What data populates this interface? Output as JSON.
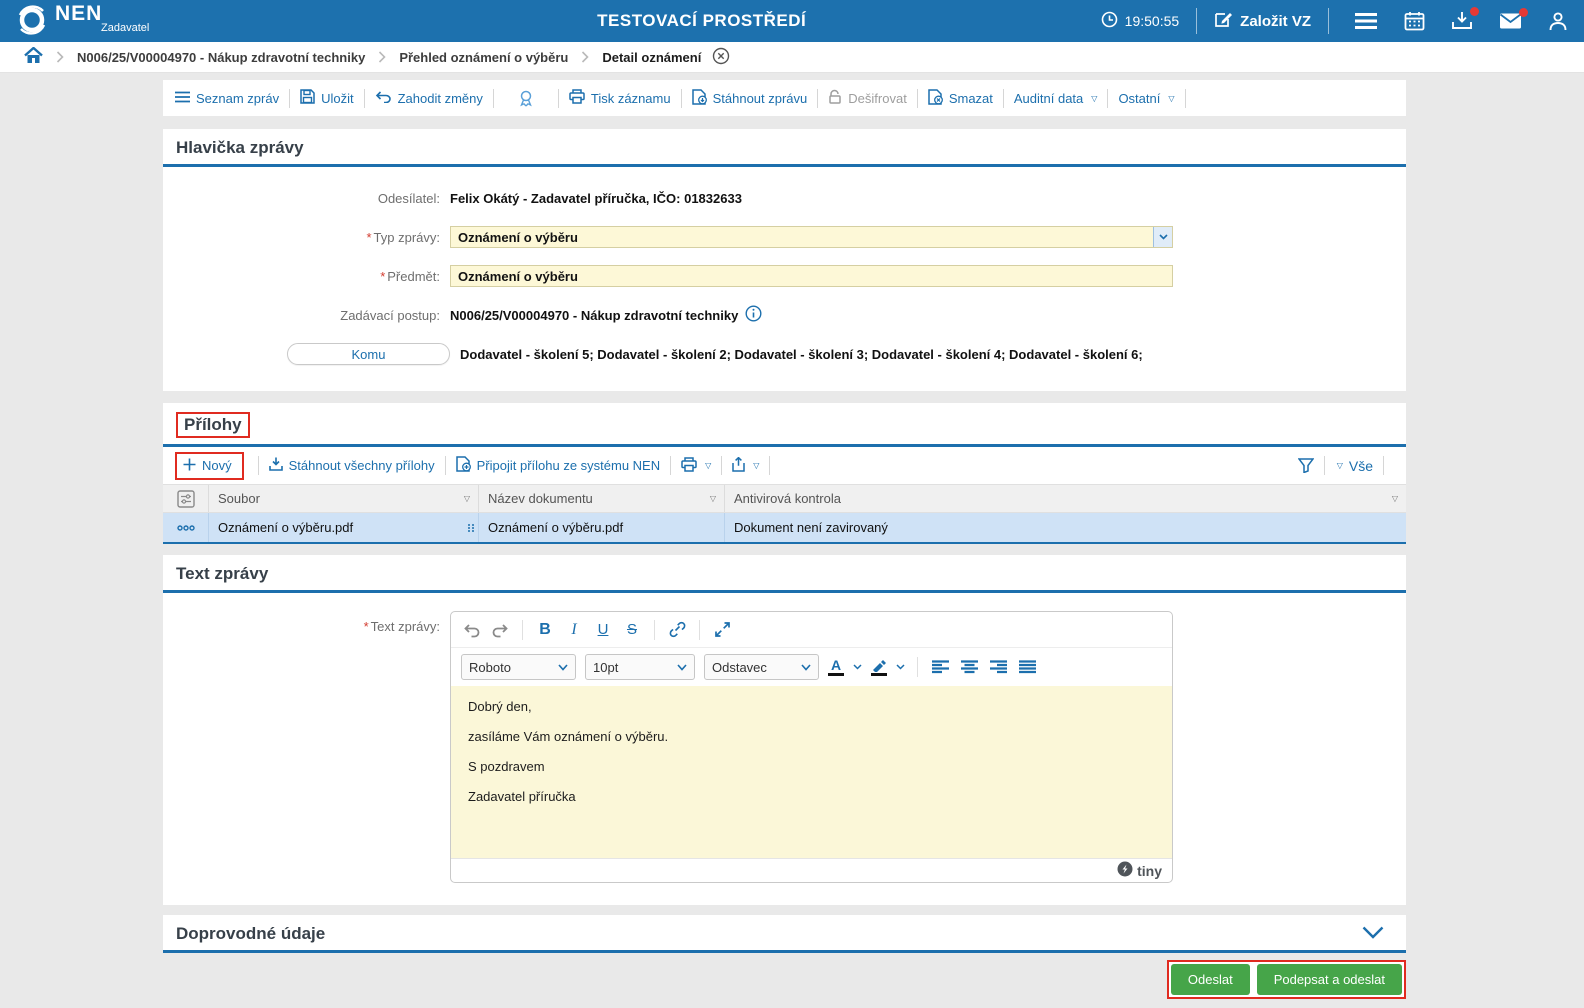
{
  "colors": {
    "header_blue": "#1d71ae",
    "accent_blue": "#1c6fad",
    "field_yellow": "#fdf8d7",
    "selected_row": "#cfe2f6",
    "success_green": "#46a549",
    "annotation_red": "#e02b20"
  },
  "header": {
    "brand": "NEN",
    "brand_sub": "Zadavatel",
    "env_title": "TESTOVACÍ PROSTŘEDÍ",
    "time": "19:50:55",
    "zalozit_vz": "Založit VZ"
  },
  "breadcrumb": {
    "items": [
      "N006/25/V00004970 - Nákup zdravotní techniky",
      "Přehled oznámení o výběru",
      "Detail oznámení"
    ]
  },
  "toolbar": {
    "seznam_zprav": "Seznam zpráv",
    "ulozit": "Uložit",
    "zahodit": "Zahodit změny",
    "tisk": "Tisk záznamu",
    "stahnout": "Stáhnout zprávu",
    "desifrovat": "Dešifrovat",
    "smazat": "Smazat",
    "auditni": "Auditní data",
    "ostatni": "Ostatní"
  },
  "hlavicka": {
    "title": "Hlavička zprávy",
    "odesilatel_label": "Odesílatel:",
    "odesilatel_value": "Felix Okátý - Zadavatel příručka, IČO: 01832633",
    "typ_label": "Typ zprávy:",
    "typ_value": "Oznámení o výběru",
    "predmet_label": "Předmět:",
    "predmet_value": "Oznámení o výběru",
    "postup_label": "Zadávací postup:",
    "postup_value": "N006/25/V00004970 - Nákup zdravotní techniky",
    "komu_label": "Komu",
    "komu_value": "Dodavatel - školení 5; Dodavatel - školení 2; Dodavatel - školení 3; Dodavatel - školení 4; Dodavatel - školení 6;"
  },
  "prilohy": {
    "title": "Přílohy",
    "novy": "Nový",
    "stahnout_vse": "Stáhnout všechny přílohy",
    "pripojit": "Připojit přílohu ze systému NEN",
    "filter_all": "Vše",
    "table": {
      "headers": [
        "Soubor",
        "Název dokumentu",
        "Antivirová kontrola"
      ],
      "rows": [
        [
          "Oznámení o výběru.pdf",
          "Oznámení o výběru.pdf",
          "Dokument není zavirovaný"
        ]
      ]
    }
  },
  "text_zpravy": {
    "title": "Text zprávy",
    "label": "Text zprávy:",
    "editor": {
      "font_name": "Roboto",
      "font_size": "10pt",
      "block": "Odstavec",
      "paragraphs": [
        "Dobrý den,",
        "zasíláme Vám oznámení o výběru.",
        "S pozdravem",
        "Zadavatel příručka"
      ],
      "brand": "tiny"
    }
  },
  "doprovodne": {
    "title": "Doprovodné údaje"
  },
  "footer": {
    "odeslat": "Odeslat",
    "podepsat": "Podepsat a odeslat"
  }
}
